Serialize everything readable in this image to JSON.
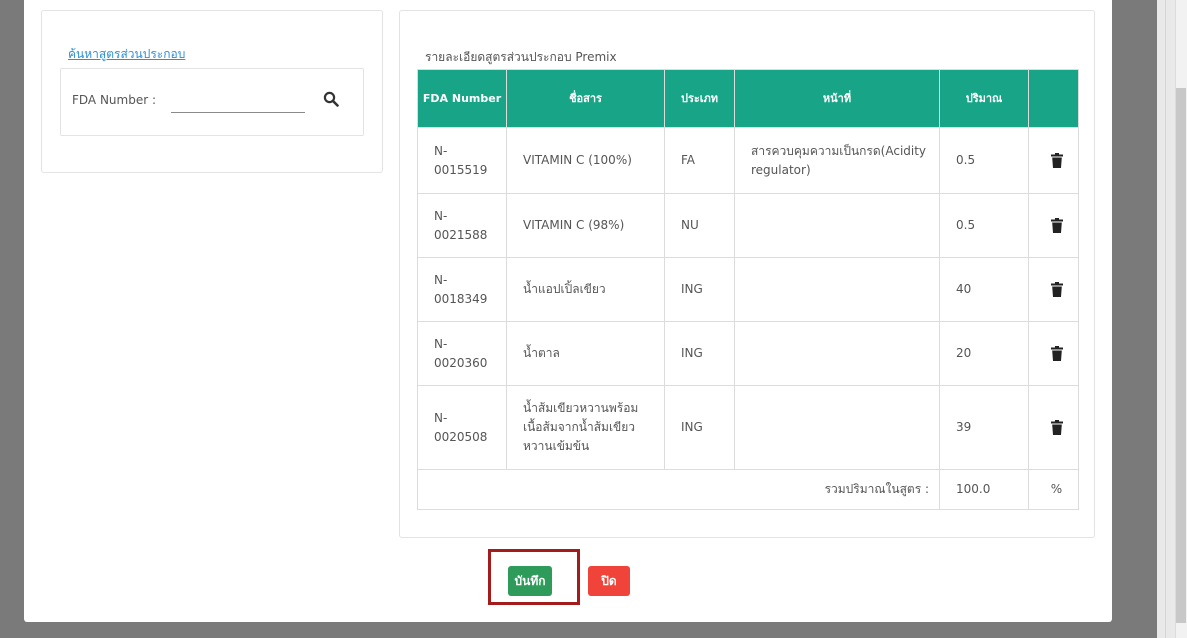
{
  "left_panel": {
    "search_link": "ค้นหาสูตรส่วนประกอบ",
    "fda_label": "FDA Number :",
    "fda_value": "",
    "search_icon": "search-icon"
  },
  "right_panel": {
    "title": "รายละเอียดสูตรส่วนประกอบ Premix",
    "table": {
      "headers": [
        "FDA Number",
        "ชื่อสาร",
        "ประเภท",
        "หน้าที่",
        "ปริมาณ",
        ""
      ],
      "rows": [
        {
          "fda": "N-0015519",
          "name": "VITAMIN C (100%)",
          "type": "FA",
          "function": "สารควบคุมความเป็นกรด(Acidity regulator)",
          "amount": "0.5"
        },
        {
          "fda": "N-0021588",
          "name": "VITAMIN C (98%)",
          "type": "NU",
          "function": "",
          "amount": "0.5"
        },
        {
          "fda": "N-0018349",
          "name": "น้ำแอปเปิ้ลเขียว",
          "type": "ING",
          "function": "",
          "amount": "40"
        },
        {
          "fda": "N-0020360",
          "name": "น้ำตาล",
          "type": "ING",
          "function": "",
          "amount": "20"
        },
        {
          "fda": "N-0020508",
          "name": "น้ำส้มเขียวหวานพร้อมเนื้อส้มจากน้ำส้มเขียวหวานเข้มข้น",
          "type": "ING",
          "function": "",
          "amount": "39"
        }
      ],
      "total_label": "รวมปริมาณในสูตร :",
      "total_value": "100.0",
      "total_unit": "%"
    }
  },
  "actions": {
    "save_label": "บันทึก",
    "close_label": "ปิด"
  },
  "colors": {
    "header_bg": "#18a587",
    "save_bg": "#2f9b5a",
    "close_bg": "#f0443a",
    "highlight_border": "#a31b1b",
    "link": "#2f8fd6"
  }
}
